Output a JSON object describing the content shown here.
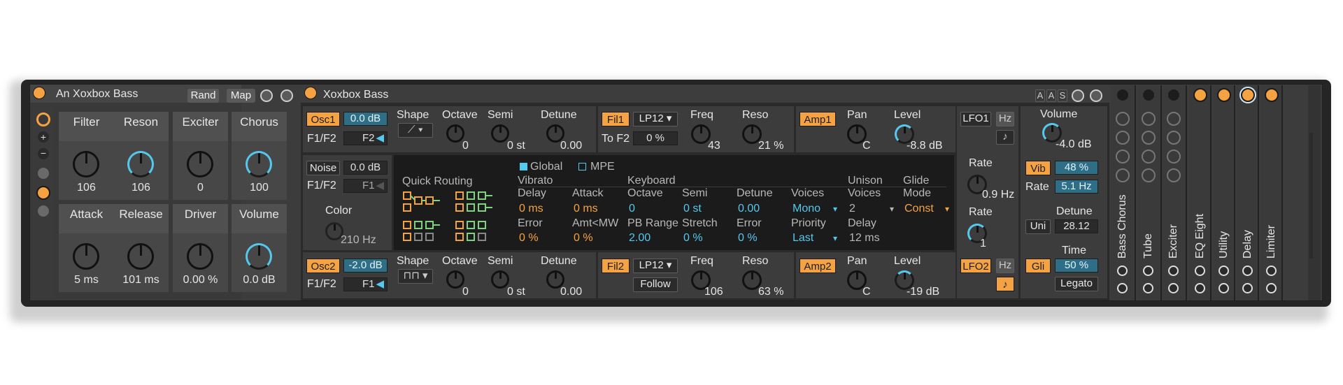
{
  "rack": {
    "title": "An Xoxbox Bass",
    "rand_label": "Rand",
    "map_label": "Map",
    "macros": [
      {
        "label": "Filter",
        "value": "106"
      },
      {
        "label": "Reson",
        "value": "106"
      },
      {
        "label": "Exciter",
        "value": "0"
      },
      {
        "label": "Chorus",
        "value": "100"
      },
      {
        "label": "Attack",
        "value": "5 ms"
      },
      {
        "label": "Release",
        "value": "101 ms"
      },
      {
        "label": "Driver",
        "value": "0.00 %"
      },
      {
        "label": "Volume",
        "value": "0.0 dB"
      }
    ]
  },
  "synth": {
    "title": "Xoxbox Bass",
    "osc1": {
      "tag": "Osc1",
      "level": "0.0 dB",
      "f1f2_label": "F1/F2",
      "f1f2_value": "F2",
      "shape_label": "Shape",
      "octave_label": "Octave",
      "octave_value": "0",
      "semi_label": "Semi",
      "semi_value": "0 st",
      "detune_label": "Detune",
      "detune_value": "0.00"
    },
    "osc2": {
      "tag": "Osc2",
      "level": "-2.0 dB",
      "f1f2_label": "F1/F2",
      "f1f2_value": "F1",
      "shape_label": "Shape",
      "octave_label": "Octave",
      "octave_value": "0",
      "semi_label": "Semi",
      "semi_value": "0 st",
      "detune_label": "Detune",
      "detune_value": "0.00"
    },
    "noise": {
      "tag": "Noise",
      "level": "0.0 dB",
      "f1f2_label": "F1/F2",
      "f1f2_value": "F1",
      "color_label": "Color",
      "color_value": "210 Hz"
    },
    "fil1": {
      "tag": "Fil1",
      "type": "LP12",
      "to_label": "To F2",
      "to_value": "0 %",
      "freq_label": "Freq",
      "freq_value": "43",
      "reso_label": "Reso",
      "reso_value": "21 %"
    },
    "fil2": {
      "tag": "Fil2",
      "type": "LP12",
      "follow_label": "Follow",
      "freq_label": "Freq",
      "freq_value": "106",
      "reso_label": "Reso",
      "reso_value": "63 %"
    },
    "amp1": {
      "tag": "Amp1",
      "pan_label": "Pan",
      "pan_value": "C",
      "level_label": "Level",
      "level_value": "-8.8 dB"
    },
    "amp2": {
      "tag": "Amp2",
      "pan_label": "Pan",
      "pan_value": "C",
      "level_label": "Level",
      "level_value": "-19 dB"
    },
    "lfo1": {
      "tag": "LFO1",
      "hz_label": "Hz",
      "rate_label": "Rate",
      "rate_value": "0.9 Hz"
    },
    "lfo2": {
      "tag": "LFO2",
      "hz_label": "Hz",
      "rate_label": "Rate",
      "rate_value": "1"
    },
    "global_panel": {
      "global_label": "Global",
      "mpe_label": "MPE",
      "quick_routing_label": "Quick Routing",
      "vibrato_label": "Vibrato",
      "keyboard_label": "Keyboard",
      "unison_label": "Unison",
      "glide_label": "Glide",
      "row1": [
        {
          "label": "Delay",
          "value": "0 ms"
        },
        {
          "label": "Attack",
          "value": "0 ms"
        },
        {
          "label": "Octave",
          "value": "0"
        },
        {
          "label": "Semi",
          "value": "0 st"
        },
        {
          "label": "Detune",
          "value": "0.00"
        },
        {
          "label": "Voices",
          "value": "Mono"
        },
        {
          "label": "Voices",
          "value": "2"
        },
        {
          "label": "Mode",
          "value": "Const"
        }
      ],
      "row2": [
        {
          "label": "Error",
          "value": "0 %"
        },
        {
          "label": "Amt<MW",
          "value": "0 %"
        },
        {
          "label": "PB Range",
          "value": "2.00"
        },
        {
          "label": "Stretch",
          "value": "0 %"
        },
        {
          "label": "Error",
          "value": "0 %"
        },
        {
          "label": "Priority",
          "value": "Last"
        },
        {
          "label": "Delay",
          "value": "12 ms"
        }
      ]
    },
    "output": {
      "volume_label": "Volume",
      "volume_value": "-4.0 dB",
      "vib_label": "Vib",
      "vib_value": "48",
      "vib_unit": "%",
      "rate_label": "Rate",
      "rate_value": "5.1",
      "rate_unit": "Hz",
      "detune_label": "Detune",
      "uni_label": "Uni",
      "detune_value": "28.12",
      "time_label": "Time",
      "gli_label": "Gli",
      "time_value": "50",
      "time_unit": "%",
      "legato_label": "Legato",
      "aas_letters": [
        "A",
        "A",
        "S"
      ]
    }
  },
  "chain": [
    "Bass Chorus",
    "Tube",
    "Exciter",
    "EQ Eight",
    "Utility",
    "Delay",
    "Limiter"
  ],
  "colors": {
    "accent_orange": "#f5a342",
    "accent_cyan": "#55c8ee",
    "routing_green": "#7fd27f"
  }
}
